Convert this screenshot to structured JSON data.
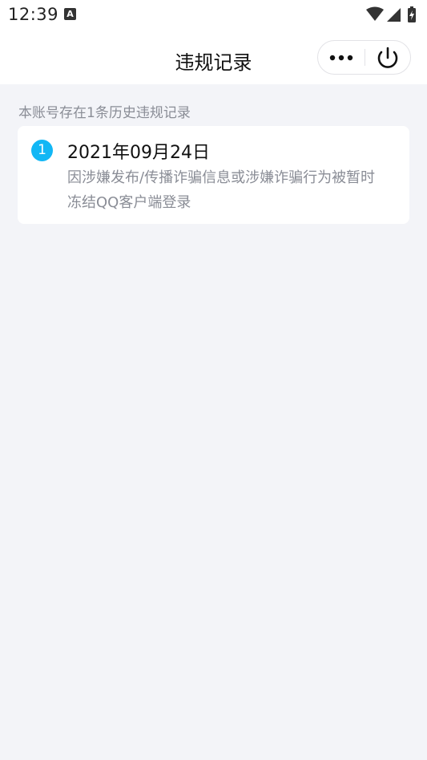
{
  "status_bar": {
    "time": "12:39",
    "notification_icon": "A",
    "icons": [
      "wifi-icon",
      "signal-icon",
      "battery-charging-icon"
    ]
  },
  "nav": {
    "title": "违规记录",
    "more_icon": "more-dots-icon",
    "power_icon": "power-icon"
  },
  "notice": "本账号存在1条历史违规记录",
  "records": [
    {
      "index": "1",
      "date": "2021年09月24日",
      "description": "因涉嫌发布/传播诈骗信息或涉嫌诈骗行为被暂时冻结QQ客户端登录"
    }
  ],
  "colors": {
    "accent": "#12b7f5",
    "background": "#f3f4f8",
    "muted_text": "#8a8d96"
  }
}
